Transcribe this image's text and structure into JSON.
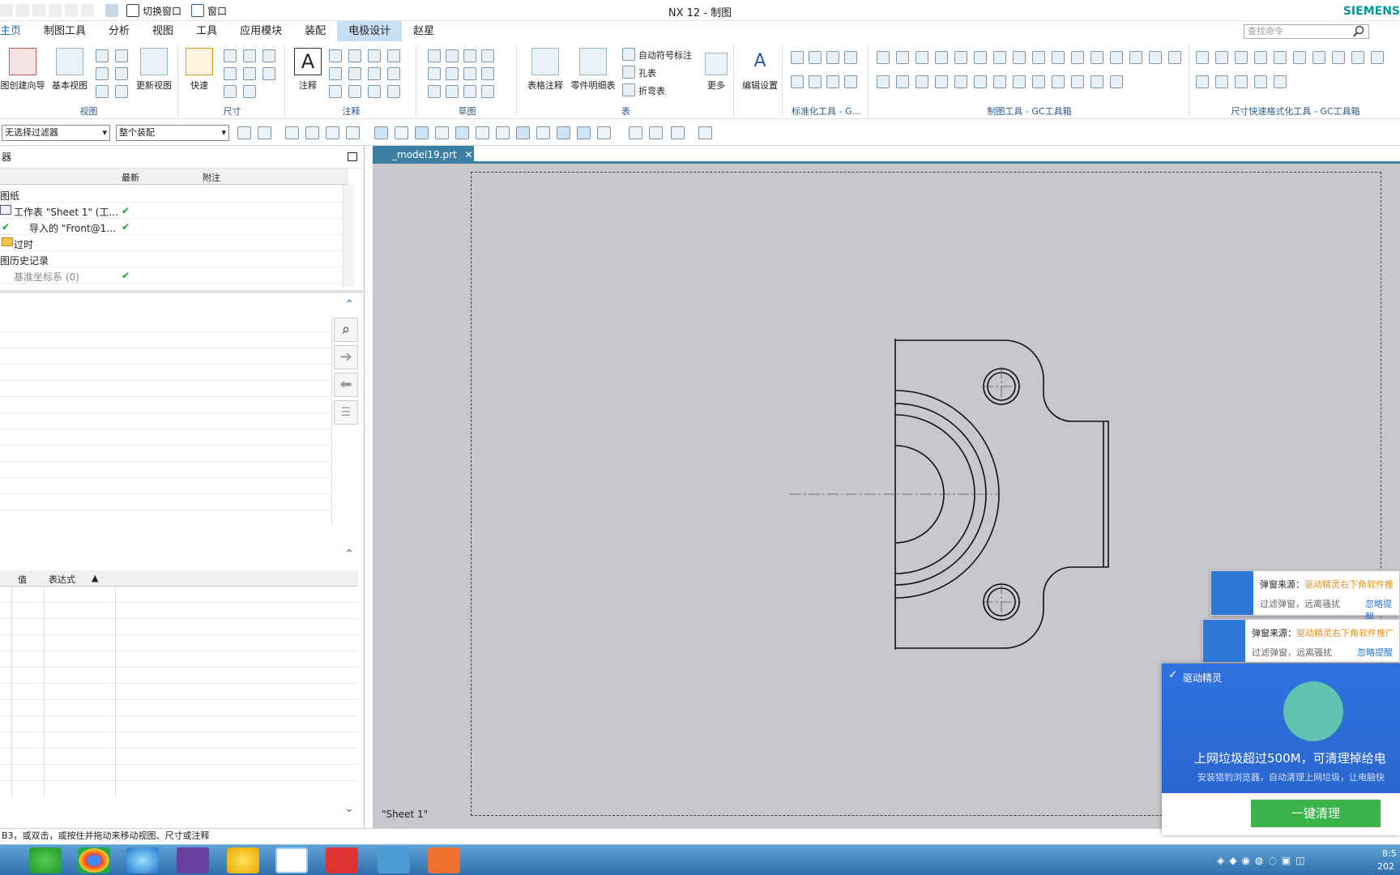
{
  "app": {
    "window_title": "NX 12 - 制图",
    "brand": "SIEMENS"
  },
  "quick_access": {
    "switch_window": "切换窗口",
    "window": "窗口"
  },
  "menu": {
    "items": [
      "主页",
      "制图工具",
      "分析",
      "视图",
      "工具",
      "应用模块",
      "装配",
      "电极设计",
      "赵星"
    ],
    "active": "主页",
    "hovered": "电极设计"
  },
  "search": {
    "placeholder": "查找命令"
  },
  "ribbon": {
    "groups": {
      "view": "视图",
      "dimension": "尺寸",
      "annotation": "注释",
      "sketch": "草图",
      "table": "表",
      "std_tools": "标准化工具 - G...",
      "drafting_tools": "制图工具 - GC工具箱",
      "dim_format": "尺寸快速格式化工具 - GC工具箱"
    },
    "buttons": {
      "view_wizard": "图创建向导",
      "base_view": "基本视图",
      "update_view": "更新视图",
      "rapid": "快速",
      "note": "注释",
      "table_note": "表格注释",
      "parts_list": "零件明细表",
      "auto_balloon": "自动符号标注",
      "hole_table": "孔表",
      "bend_table": "折弯表",
      "more": "更多",
      "edit_settings": "编辑设置"
    }
  },
  "filter": {
    "selection_filter": "无选择过滤器",
    "scope": "整个装配"
  },
  "navigator": {
    "title": "器",
    "columns": [
      "",
      "最新",
      "附注"
    ],
    "rows": [
      {
        "label": "图纸",
        "ok": false
      },
      {
        "label": "工作表 \"Sheet 1\" (工...",
        "ok": true
      },
      {
        "label": "导入的 \"Front@1...",
        "ok": true
      },
      {
        "label": "过时",
        "ok": false
      },
      {
        "label": "图历史记录",
        "ok": false
      },
      {
        "label": "基准坐标系 (0)",
        "ok": true
      }
    ]
  },
  "expr_table": {
    "columns": [
      "值",
      "表达式"
    ]
  },
  "doc_tab": {
    "name": "_model19.prt"
  },
  "sheet": {
    "label": "\"Sheet 1\""
  },
  "status_bar": {
    "message": "B3，或双击，或按住并拖动来移动视图、尺寸或注释"
  },
  "popups": [
    {
      "source_label": "弹窗来源：",
      "source": "驱动精灵右下角软件推",
      "tip": "过滤弹窗，远离骚扰",
      "action": "忽略提醒"
    },
    {
      "source_label": "弹窗来源：",
      "source": "驱动精灵右下角软件推广",
      "tip": "过滤弹窗，远离骚扰",
      "action": "忽略提醒"
    }
  ],
  "ad": {
    "title": "驱动精灵",
    "headline": "上网垃圾超过500M，可清理掉给电",
    "sub": "安装猎豹浏览器，自动清理上网垃圾，让电脑快",
    "button": "一键清理"
  },
  "taskbar": {
    "time": "8:5",
    "date": "202"
  },
  "colors": {
    "accent": "#3c7fa3",
    "ribbon_label": "#2c5a8f",
    "canvas": "#c8c8cc",
    "check": "#1c9b2e",
    "ad_button": "#3bb34b",
    "ad_blue": "#2e72de"
  }
}
